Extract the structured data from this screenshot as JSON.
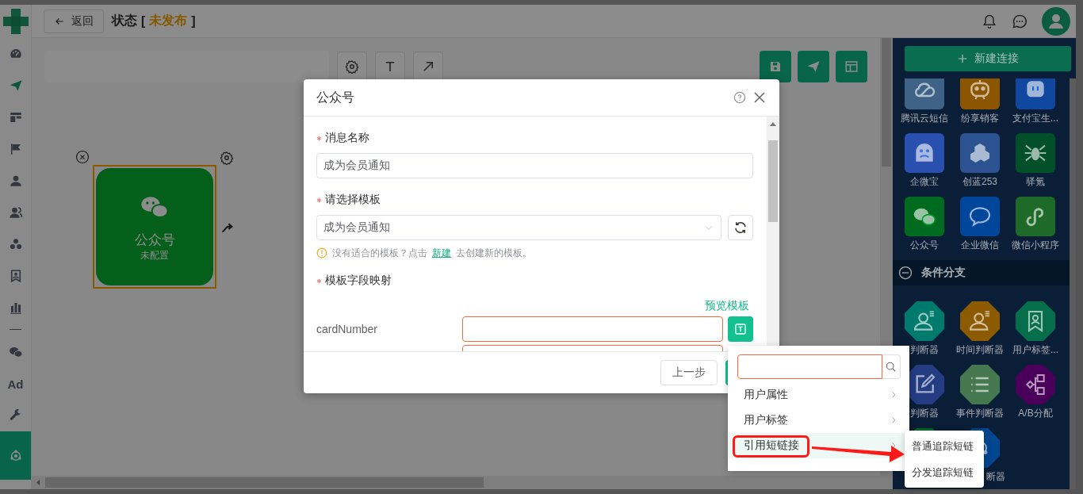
{
  "header": {
    "back_button": "返回",
    "title": "状态",
    "bracket_open": "[",
    "status": "未发布",
    "bracket_close": "]"
  },
  "sidebar": {
    "groups": [
      {
        "items": [
          {
            "kind": "icon",
            "selected": false,
            "active": false
          },
          {
            "kind": "icon",
            "selected": false,
            "active": true
          },
          {
            "kind": "icon",
            "selected": false,
            "active": false
          },
          {
            "kind": "icon",
            "selected": false,
            "active": false
          },
          {
            "kind": "icon",
            "selected": false,
            "active": false
          },
          {
            "kind": "icon",
            "selected": false,
            "active": false
          },
          {
            "kind": "icon",
            "selected": false,
            "active": false
          },
          {
            "kind": "icon",
            "selected": false,
            "active": false
          },
          {
            "kind": "icon",
            "selected": false,
            "active": false
          }
        ]
      },
      {
        "items": [
          {
            "kind": "icon",
            "selected": false,
            "active": false
          },
          {
            "kind": "text",
            "label": "Ad",
            "selected": false,
            "active": false
          },
          {
            "kind": "icon",
            "selected": false,
            "active": false
          },
          {
            "kind": "icon",
            "selected": true,
            "active": false
          }
        ]
      }
    ]
  },
  "canvas": {
    "node": {
      "title": "公众号",
      "subtitle": "未配置",
      "selected": true
    }
  },
  "right_panel": {
    "new_button": "新建连接",
    "connectors": [
      {
        "label": "腾讯云短信",
        "color": "#3e6386"
      },
      {
        "label": "纷享销客",
        "color": "#8c5500"
      },
      {
        "label": "支付宝生...",
        "color": "#1048a0"
      },
      {
        "label": "企微宝",
        "color": "#2a50af"
      },
      {
        "label": "创蓝253",
        "color": "#2c5291"
      },
      {
        "label": "驿氪",
        "color": "#02502a"
      },
      {
        "label": "公众号",
        "color": "#006a1e"
      },
      {
        "label": "企业微信",
        "color": "#00469a"
      },
      {
        "label": "微信小程序",
        "color": "#1e6a28"
      }
    ],
    "section": {
      "title": "条件分支",
      "expanded": true
    },
    "conditions": [
      {
        "label": "判断器",
        "color": "#007a6d"
      },
      {
        "label": "时间判断器",
        "color": "#8c5a00"
      },
      {
        "label": "用户标签...",
        "color": "#066e4a"
      },
      {
        "label": "判断器",
        "color": "#233c82"
      },
      {
        "label": "事件判断器",
        "color": "#46784f"
      },
      {
        "label": "A/B分配",
        "color": "#4a005a"
      },
      {
        "color": "#006a20"
      },
      {
        "label": "断器",
        "color": "#004690"
      }
    ]
  },
  "modal": {
    "title": "公众号",
    "message_name": {
      "label": "消息名称",
      "required": true,
      "value": "成为会员通知"
    },
    "template": {
      "label": "请选择模板",
      "required": true,
      "value": "成为会员通知"
    },
    "hint": {
      "before": "没有适合的模板？点击",
      "link": "新建",
      "after": "去创建新的模板。"
    },
    "mapping": {
      "label": "模板字段映射",
      "required": true,
      "preview_link": "预览模板",
      "rows": [
        {
          "name": "cardNumber",
          "error": true
        },
        {
          "error": true
        }
      ]
    },
    "footer": {
      "back_button": "上一步"
    }
  },
  "field_menu": {
    "search": {
      "focused": true
    },
    "items": [
      {
        "label": "用户属性",
        "selected": false
      },
      {
        "label": "用户标签",
        "selected": false
      },
      {
        "label": "引用短链接",
        "selected": true
      }
    ],
    "submenu": [
      {
        "label": "普通追踪短链"
      },
      {
        "label": "分发追踪短链"
      }
    ]
  }
}
